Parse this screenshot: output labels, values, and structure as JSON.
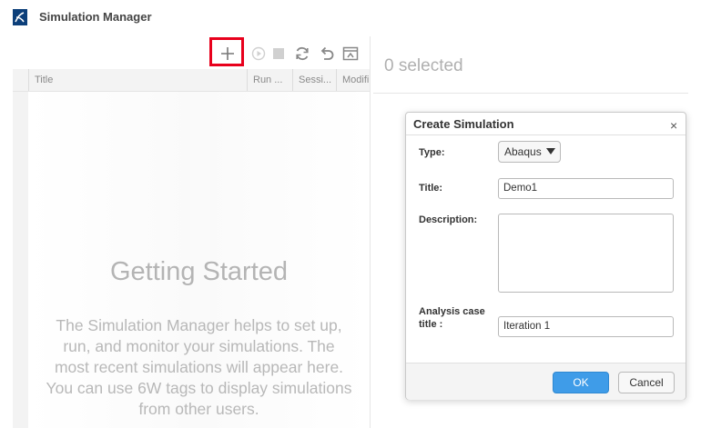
{
  "app": {
    "title": "Simulation Manager",
    "logo_icon": "ds-logo-icon"
  },
  "toolbar": {
    "icons": [
      "plus-icon",
      "play-circle-icon",
      "stop-icon",
      "refresh-icon",
      "undo-icon",
      "screen-icon"
    ],
    "highlight_color": "#e8001c"
  },
  "grid": {
    "columns": [
      "Title",
      "Run ...",
      "Sessi...",
      "Modifi"
    ]
  },
  "empty_state": {
    "title": "Getting Started",
    "description": [
      "The Simulation Manager helps to set up,",
      "run, and monitor your simulations. The",
      "most recent simulations will appear here.",
      "You can use 6W tags to display simulations",
      "from other users."
    ]
  },
  "selection": {
    "text": "0 selected"
  },
  "dialog": {
    "title": "Create Simulation",
    "close": "×",
    "type_label": "Type:",
    "type_value": "Abaqus",
    "title_label": "Title:",
    "title_value": "Demo1",
    "description_label": "Description:",
    "description_value": "",
    "analysis_label_line1": "Analysis case",
    "analysis_label_line2": "title :",
    "analysis_value": "Iteration 1",
    "ok_label": "OK",
    "cancel_label": "Cancel",
    "ok_color": "#3f9ce8"
  }
}
